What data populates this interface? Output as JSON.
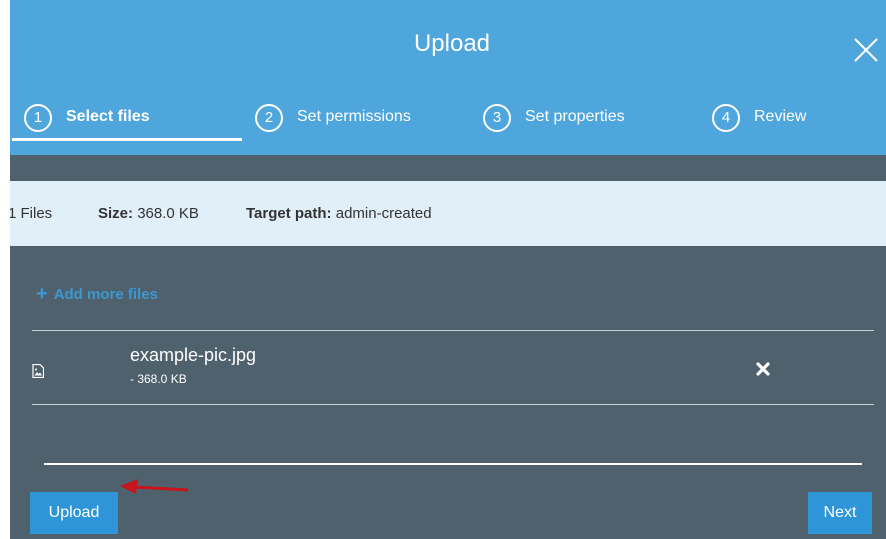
{
  "dialog": {
    "title": "Upload",
    "close_icon": "close-icon"
  },
  "steps": [
    {
      "number": "1",
      "label": "Select files",
      "active": true
    },
    {
      "number": "2",
      "label": "Set permissions",
      "active": false
    },
    {
      "number": "3",
      "label": "Set properties",
      "active": false
    },
    {
      "number": "4",
      "label": "Review",
      "active": false
    }
  ],
  "summary": {
    "files_count": "1 Files",
    "size_label": "Size:",
    "size_value": "368.0 KB",
    "target_label": "Target path:",
    "target_value": "admin-created"
  },
  "add_files": {
    "icon": "plus-icon",
    "label": "Add more files"
  },
  "files": [
    {
      "name": "example-pic.jpg",
      "size": "- 368.0 KB",
      "icon": "image-file-icon",
      "remove_icon": "remove-icon"
    }
  ],
  "footer": {
    "upload_label": "Upload",
    "next_label": "Next"
  },
  "colors": {
    "header": "#4ea6dc",
    "body": "#4f616d",
    "summary": "#e1eff8",
    "button": "#2e96d8",
    "link": "#3c98d0",
    "annotation_arrow": "#c8141b"
  }
}
